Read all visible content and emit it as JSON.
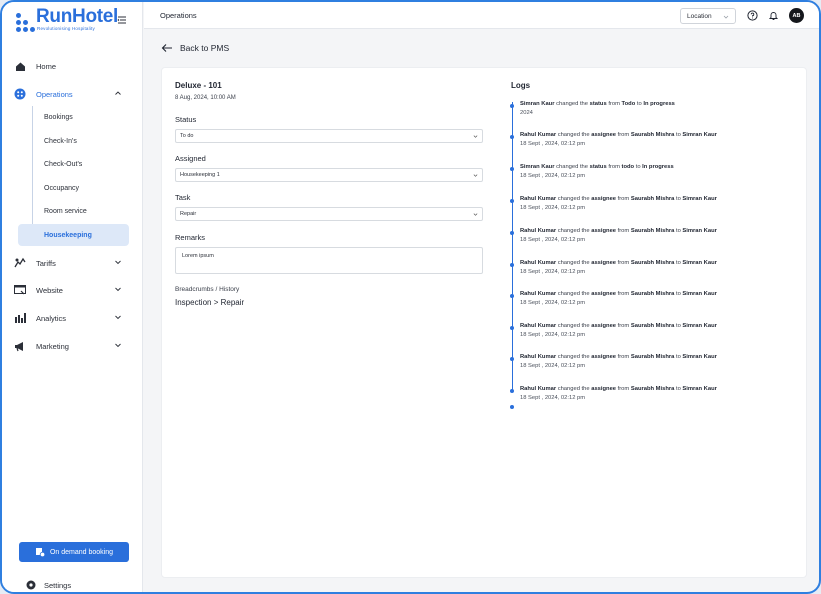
{
  "brand": {
    "name": "RunHotel",
    "tagline": "Revolutionising Hospitality"
  },
  "sidebar": {
    "items": [
      {
        "label": "Home",
        "icon": "home-icon"
      },
      {
        "label": "Operations",
        "icon": "operations-icon",
        "expanded": true
      },
      {
        "label": "Tariffs",
        "icon": "tariffs-icon"
      },
      {
        "label": "Website",
        "icon": "website-icon"
      },
      {
        "label": "Analytics",
        "icon": "analytics-icon"
      },
      {
        "label": "Marketing",
        "icon": "marketing-icon"
      }
    ],
    "sub_items": [
      "Bookings",
      "Check-In's",
      "Check-Out's",
      "Occupancy",
      "Room service",
      "Housekeeping"
    ],
    "selected_sub_item": "Housekeeping",
    "on_demand_label": "On demand booking",
    "settings_label": "Settings"
  },
  "header": {
    "title": "Operations",
    "location_label": "Location",
    "avatar_initials": "AB"
  },
  "back_label": "Back to PMS",
  "details": {
    "room": "Deluxe - 101",
    "datetime": "8 Aug, 2024,  10:00 AM",
    "status_label": "Status",
    "status_value": "To do",
    "assigned_label": "Assigned",
    "assigned_value": "Housekeeping 1",
    "task_label": "Task",
    "task_value": "Repair",
    "remarks_label": "Remarks",
    "remarks_value": "Lorem ipsum",
    "breadcrumbs_label": "Breadcrumbs / History",
    "breadcrumbs_path": "Inspection > Repair"
  },
  "logs": {
    "title": "Logs",
    "entries": [
      {
        "user": "Simran Kaur",
        "text1": " changed the ",
        "field": "status",
        "text2": " from ",
        "from": "Todo",
        "text3": " to ",
        "to": "In progress",
        "time": "2024"
      },
      {
        "user": "Rahul Kumar",
        "text1": " changed the ",
        "field": "assignee",
        "text2": " from ",
        "from": "Saurabh Mishra",
        "text3": " to ",
        "to": "Simran Kaur",
        "time": "18 Sept , 2024, 02:12 pm"
      },
      {
        "user": "Simran Kaur",
        "text1": " changed the ",
        "field": "status",
        "text2": " from ",
        "from": "todo",
        "text3": " to ",
        "to": "In progress",
        "time": "18 Sept , 2024, 02:12 pm"
      },
      {
        "user": "Rahul Kumar",
        "text1": " changed the ",
        "field": "assignee",
        "text2": " from ",
        "from": "Saurabh Mishra",
        "text3": " to ",
        "to": "Simran Kaur",
        "time": "18 Sept , 2024, 02:12 pm"
      },
      {
        "user": "Rahul Kumar",
        "text1": " changed the ",
        "field": "assignee",
        "text2": " from ",
        "from": "Saurabh Mishra",
        "text3": " to ",
        "to": "Simran Kaur",
        "time": "18 Sept , 2024, 02:12 pm"
      },
      {
        "user": "Rahul Kumar",
        "text1": " changed the ",
        "field": "assignee",
        "text2": " from ",
        "from": "Saurabh Mishra",
        "text3": " to ",
        "to": "Simran Kaur",
        "time": "18 Sept , 2024, 02:12 pm"
      },
      {
        "user": "Rahul Kumar",
        "text1": " changed the ",
        "field": "assignee",
        "text2": " from ",
        "from": "Saurabh Mishra",
        "text3": " to ",
        "to": "Simran Kaur",
        "time": "18 Sept , 2024, 02:12 pm"
      },
      {
        "user": "Rahul Kumar",
        "text1": " changed the ",
        "field": "assignee",
        "text2": " from ",
        "from": "Saurabh Mishra",
        "text3": " to ",
        "to": "Simran Kaur",
        "time": "18 Sept , 2024, 02:12 pm"
      },
      {
        "user": "Rahul Kumar",
        "text1": " changed the ",
        "field": "assignee",
        "text2": " from ",
        "from": "Saurabh Mishra",
        "text3": " to ",
        "to": "Simran Kaur",
        "time": "18 Sept , 2024, 02:12 pm"
      },
      {
        "user": "Rahul Kumar",
        "text1": " changed the ",
        "field": "assignee",
        "text2": " from ",
        "from": "Saurabh Mishra",
        "text3": " to ",
        "to": "Simran Kaur",
        "time": "18 Sept , 2024, 02:12 pm"
      }
    ]
  },
  "colors": {
    "accent": "#2a6fdb",
    "selected_bg": "#dde8f8",
    "frame_border": "#2f7fe0"
  }
}
